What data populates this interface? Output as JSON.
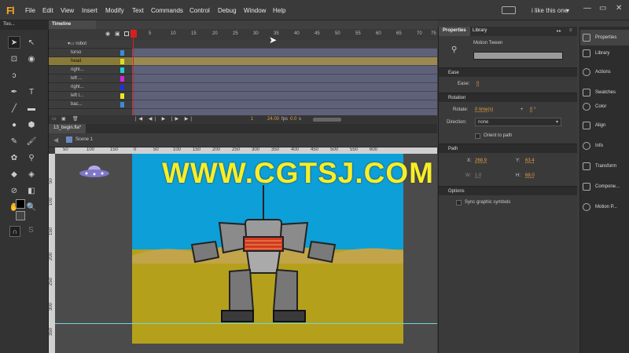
{
  "app": {
    "logo": "Fl"
  },
  "menubar": {
    "items": [
      "File",
      "Edit",
      "View",
      "Insert",
      "Modify",
      "Text",
      "Commands",
      "Control",
      "Debug",
      "Window",
      "Help"
    ],
    "workspace": "i like this one",
    "workspace_arrow": "▾"
  },
  "window_controls": {
    "minimize": "—",
    "maximize": "▭",
    "close": "✕"
  },
  "tools": {
    "tab_label": "Too...",
    "items": [
      "selection",
      "subselection",
      "free-transform",
      "3d-rotation",
      "lasso",
      "pen",
      "text",
      "line",
      "rectangle",
      "oval",
      "polystar",
      "pencil",
      "brush",
      "deco",
      "bone",
      "bind",
      "paint-bucket",
      "ink-bottle",
      "eyedropper",
      "eraser",
      "hand",
      "zoom",
      "stroke-color",
      "fill-color",
      "snap",
      "smooth"
    ]
  },
  "timeline": {
    "tab_label": "Timeline",
    "frame_numbers": [
      "1",
      "5",
      "10",
      "15",
      "20",
      "25",
      "30",
      "35",
      "40",
      "45",
      "50",
      "55",
      "60",
      "65",
      "70",
      "75"
    ],
    "folder": "robot",
    "layers": [
      {
        "name": "torso",
        "color": "#3a8dd8"
      },
      {
        "name": "head",
        "color": "#e0e020"
      },
      {
        "name": "right...",
        "color": "#22d0d0"
      },
      {
        "name": "left ...",
        "color": "#e020e0"
      },
      {
        "name": "right...",
        "color": "#2030e0"
      },
      {
        "name": "left l...",
        "color": "#e8e820"
      },
      {
        "name": "bac...",
        "color": "#3a8dd8"
      }
    ],
    "current_frame": "1",
    "fps": "24.00",
    "fps_unit": "fps",
    "time": "0.0",
    "time_unit": "s"
  },
  "document": {
    "tab": "13_begin.fla*",
    "scene": "Scene 1"
  },
  "ruler_top": [
    "50",
    "100",
    "150",
    "0",
    "50",
    "100",
    "150",
    "200",
    "250",
    "300",
    "350",
    "400",
    "450",
    "500",
    "550",
    "600"
  ],
  "ruler_left": [
    "50",
    "100",
    "150",
    "200",
    "250",
    "300",
    "350"
  ],
  "watermark": "WWW.CGTSJ.COM",
  "properties": {
    "tabs": [
      "Properties",
      "Library"
    ],
    "type": "Motion Tween",
    "ease_section": "Ease",
    "ease_label": "Ease:",
    "ease_value": "0",
    "rotation_section": "Rotation",
    "rotate_label": "Rotate:",
    "rotate_times": "0 time(s)",
    "plus": "+",
    "rotate_deg": "0",
    "deg": "°",
    "direction_label": "Direction:",
    "direction_value": "none",
    "orient_label": "Orient to path",
    "path_section": "Path",
    "x_label": "X:",
    "x_value": "268.9",
    "y_label": "Y:",
    "y_value": "63.4",
    "w_label": "W:",
    "w_value": "1.0",
    "h_label": "H:",
    "h_value": "68.0",
    "options_section": "Options",
    "sync_label": "Sync graphic symbols"
  },
  "dock": {
    "items": [
      "Properties",
      "Library",
      "Actions",
      "Swatches",
      "Color",
      "Align",
      "Info",
      "Transform",
      "Compone...",
      "Motion P..."
    ]
  }
}
